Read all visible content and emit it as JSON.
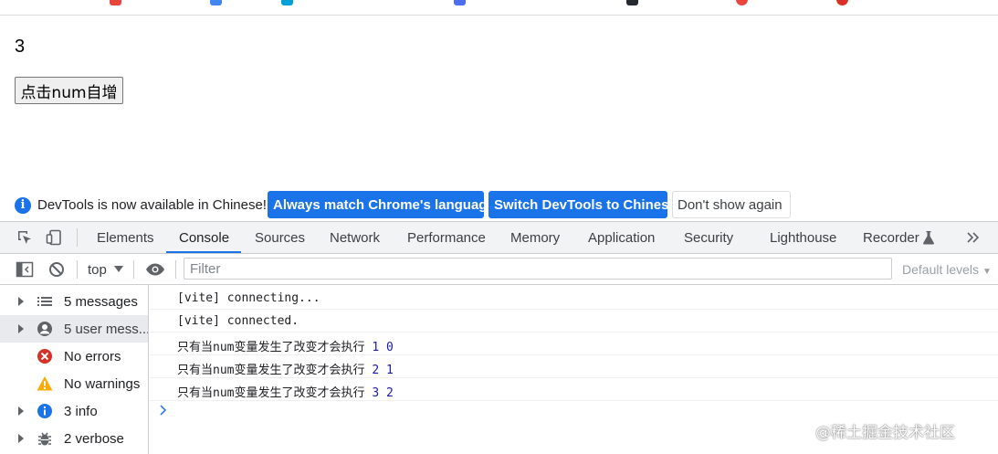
{
  "page": {
    "counter": "3",
    "button_label": "点击num自增"
  },
  "infobar": {
    "message": "DevTools is now available in Chinese!",
    "btn_match": "Always match Chrome's language",
    "btn_switch": "Switch DevTools to Chinese",
    "btn_dismiss": "Don't show again"
  },
  "tabs": [
    "Elements",
    "Console",
    "Sources",
    "Network",
    "Performance",
    "Memory",
    "Application",
    "Security",
    "Lighthouse",
    "Recorder"
  ],
  "console_toolbar": {
    "context": "top",
    "filter_placeholder": "Filter",
    "levels": "Default levels"
  },
  "sidebar": [
    {
      "label": "5 messages",
      "icon": "list-icon"
    },
    {
      "label": "5 user mess...",
      "icon": "user-icon"
    },
    {
      "label": "No errors",
      "icon": "error-icon"
    },
    {
      "label": "No warnings",
      "icon": "warning-icon"
    },
    {
      "label": "3 info",
      "icon": "info-icon"
    },
    {
      "label": "2 verbose",
      "icon": "bug-icon"
    }
  ],
  "logs": [
    {
      "text": "[vite] connecting..."
    },
    {
      "text": "[vite] connected."
    },
    {
      "text": "只有当num变量发生了改变才会执行",
      "a": "1",
      "b": "0"
    },
    {
      "text": "只有当num变量发生了改变才会执行",
      "a": "2",
      "b": "1"
    },
    {
      "text": "只有当num变量发生了改变才会执行",
      "a": "3",
      "b": "2"
    }
  ],
  "watermark": "@稀土掘金技术社区",
  "colors": {
    "accent": "#1a73e8",
    "error": "#d93025",
    "warning": "#f9ab00"
  }
}
